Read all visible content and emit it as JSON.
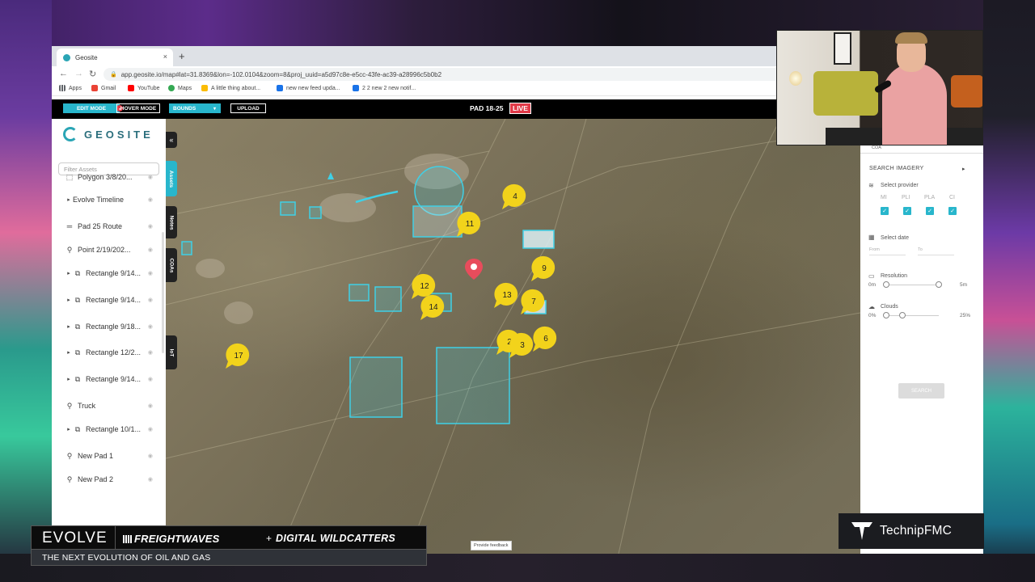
{
  "browser": {
    "tab_title": "Geosite",
    "tab_close": "×",
    "new_tab": "+",
    "url": "app.geosite.io/map#lat=31.8369&lon=-102.0104&zoom=8&proj_uuid=a5d97c8e-e5cc-43fe-ac39-a28996c5b0b2",
    "bookmarks": [
      {
        "label": "Apps",
        "color": "#5f6368"
      },
      {
        "label": "Gmail",
        "color": "#ea4335"
      },
      {
        "label": "YouTube",
        "color": "#ff0000"
      },
      {
        "label": "Maps",
        "color": "#34a853"
      },
      {
        "label": "A little thing about...",
        "color": "#fbbc05"
      },
      {
        "label": "new new feed upda...",
        "color": "#1a73e8"
      },
      {
        "label": "2 2 new 2 new notif...",
        "color": "#1a73e8"
      }
    ]
  },
  "appbar": {
    "edit_mode": "EDIT MODE",
    "hover_mode": "HOVER MODE",
    "bounds": "BOUNDS",
    "upload": "UPLOAD",
    "pad_title": "PAD 18-25",
    "live": "LIVE"
  },
  "sidebar": {
    "logo": "GEOSITE",
    "filter_placeholder": "Filter Assets",
    "collapse_icon": "«",
    "tabs": [
      "Assets",
      "Notes",
      "COAs",
      "IoT"
    ],
    "assets": [
      {
        "label": "Polygon 3/8/20...",
        "icon": "polygon-icon",
        "chevron": false
      },
      {
        "label": "Evolve Timeline",
        "icon": "",
        "chevron": true
      },
      {
        "label": "Pad 25 Route",
        "icon": "route-icon",
        "chevron": false
      },
      {
        "label": "Point 2/19/202...",
        "icon": "pin-icon",
        "chevron": false
      },
      {
        "label": "Rectangle 9/14...",
        "icon": "rectangle-icon",
        "chevron": true
      },
      {
        "label": "Rectangle 9/14...",
        "icon": "rectangle-icon",
        "chevron": true
      },
      {
        "label": "Rectangle 9/18...",
        "icon": "rectangle-icon",
        "chevron": true
      },
      {
        "label": "Rectangle 12/2...",
        "icon": "rectangle-icon",
        "chevron": true
      },
      {
        "label": "Rectangle 9/14...",
        "icon": "rectangle-icon",
        "chevron": true
      },
      {
        "label": "Truck",
        "icon": "pin-icon",
        "chevron": false
      },
      {
        "label": "Rectangle 10/1...",
        "icon": "rectangle-icon",
        "chevron": true
      },
      {
        "label": "New Pad 1",
        "icon": "pin-icon",
        "chevron": false
      },
      {
        "label": "New Pad 2",
        "icon": "pin-icon",
        "chevron": false
      }
    ]
  },
  "map": {
    "markers": [
      "4",
      "11",
      "9",
      "12",
      "13",
      "7",
      "14",
      "2",
      "3",
      "6",
      "17"
    ],
    "provide_feedback": "Provide feedback"
  },
  "panel": {
    "tab": "COA",
    "search_imagery": "SEARCH IMAGERY",
    "select_provider": "Select provider",
    "providers": [
      "MI",
      "PLI",
      "PLA",
      "CI"
    ],
    "select_date": "Select date",
    "from": "From",
    "to": "To",
    "resolution": "Resolution",
    "resolution_min": "0m",
    "resolution_max": "5m",
    "clouds": "Clouds",
    "clouds_min": "0%",
    "clouds_max": "25%",
    "search_button": "SEARCH"
  },
  "overlay": {
    "evolve": "EVOLVE",
    "freightwaves": "FREIGHTWAVES",
    "plus": "+",
    "digital_wildcatters": "DIGITAL WILDCATTERS",
    "tagline": "THE NEXT EVOLUTION OF OIL AND GAS",
    "technip": "TechnipFMC"
  }
}
